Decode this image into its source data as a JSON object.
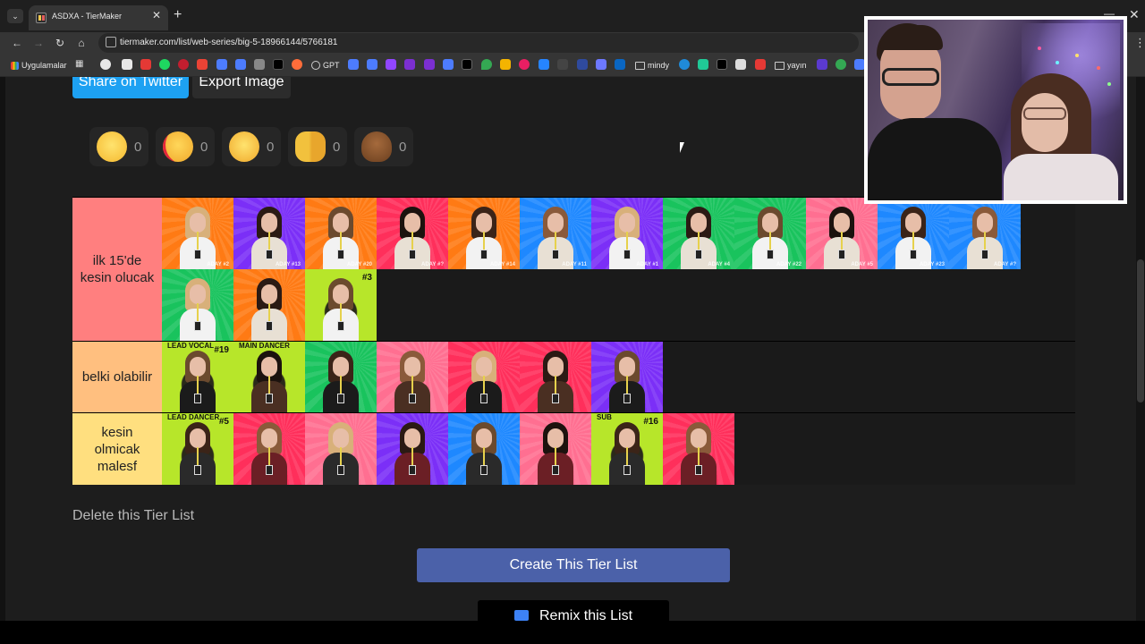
{
  "browser": {
    "tab_title": "ASDXA - TierMaker",
    "tab_close": "✕",
    "new_tab": "+",
    "url": "tiermaker.com/list/web-series/big-5-18966144/5766181",
    "bookmarks": {
      "apps_label": "Uygulamalar",
      "gpt_label": "GPT",
      "mindy_label": "mindy",
      "yayin_label": "yayın"
    }
  },
  "page": {
    "share_label": "Share on Twitter",
    "export_label": "Export Image",
    "reactions": [
      {
        "name": "grinning",
        "count": "0"
      },
      {
        "name": "heart-eyes",
        "count": "0"
      },
      {
        "name": "tears-of-joy",
        "count": "0"
      },
      {
        "name": "raised-hands",
        "count": "0"
      },
      {
        "name": "poop",
        "count": "0"
      }
    ],
    "tiers": [
      {
        "label": "ilk 15'de kesin olucak",
        "color": "#ff7f7f",
        "items": [
          "ADAY #2",
          "ADAY #13",
          "ADAY #20",
          "ADAY #?",
          "ADAY #14",
          "ADAY #11",
          "ADAY #1",
          "ADAY #4",
          "ADAY #22",
          "ADAY #5",
          "ADAY #23",
          "ADAY #?",
          "",
          "",
          "#3"
        ]
      },
      {
        "label": "belki olabilir",
        "color": "#ffbf7f",
        "items": [
          "#19",
          "",
          "",
          "",
          "",
          "",
          ""
        ]
      },
      {
        "label": "kesin olmicak malesf",
        "color": "#ffdf7f",
        "items": [
          "#5",
          "",
          "",
          "",
          "",
          "",
          "#16",
          ""
        ]
      }
    ],
    "delete_label": "Delete this Tier List",
    "create_label": "Create This Tier List",
    "remix_label": "Remix this List"
  },
  "colors": {
    "twitter": "#1da1f2",
    "create": "#4b61a9"
  }
}
